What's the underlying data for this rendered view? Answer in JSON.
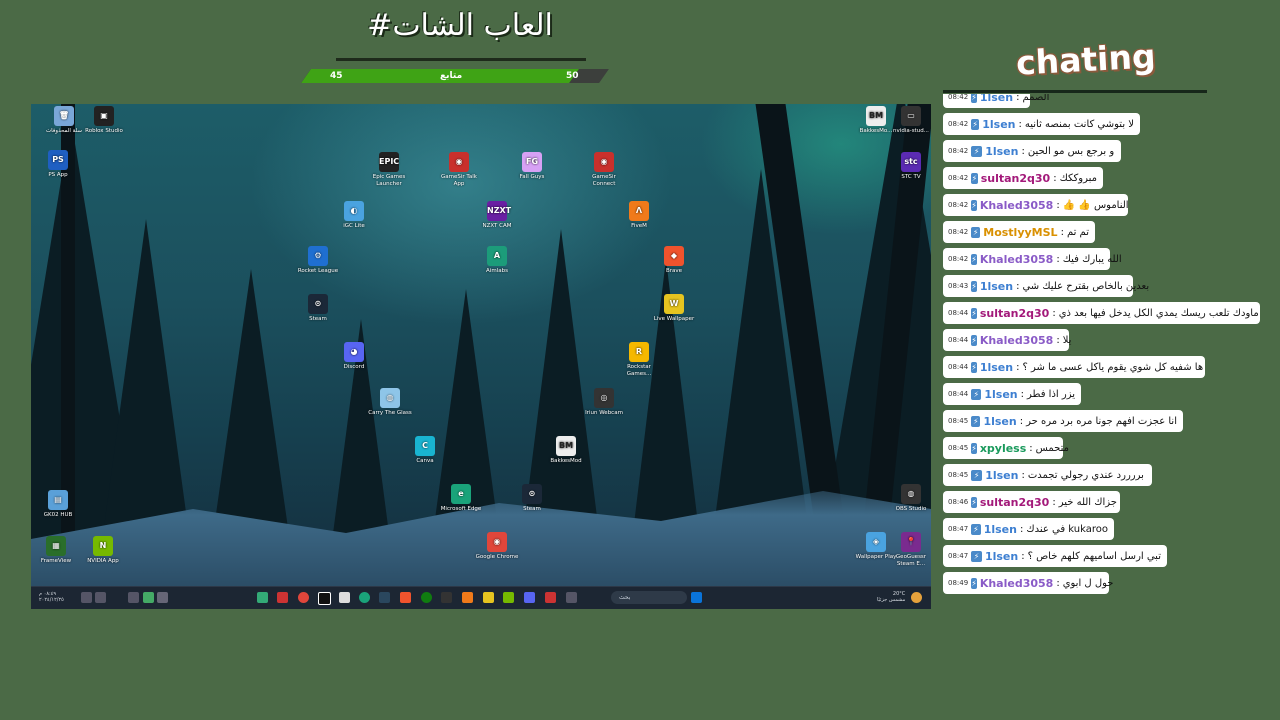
{
  "header": {
    "title": "#العاب الشات",
    "goal": {
      "label": "متابع",
      "current": "45",
      "target": "50",
      "progress": 0.9
    }
  },
  "desktop": {
    "icons": [
      {
        "label": "سلة المحذوفات",
        "color": "#7aa7d8",
        "glyph": "🗑"
      },
      {
        "label": "Roblox Studio",
        "color": "#222",
        "glyph": "▣"
      },
      {
        "label": "PS App",
        "color": "#1f5fc2",
        "glyph": "PS"
      },
      {
        "label": "Epic Games Launcher",
        "color": "#222",
        "glyph": "EPIC"
      },
      {
        "label": "GameSir Talk App",
        "color": "#c9302c",
        "glyph": "◉"
      },
      {
        "label": "Fall Guys",
        "color": "#d7a1f5",
        "glyph": "FG"
      },
      {
        "label": "GameSir Connect",
        "color": "#c9302c",
        "glyph": "◉"
      },
      {
        "label": "iGC Lite",
        "color": "#4aa3e0",
        "glyph": "◐"
      },
      {
        "label": "NZXT CAM",
        "color": "#6a1fa3",
        "glyph": "NZXT"
      },
      {
        "label": "FiveM",
        "color": "#f07a1a",
        "glyph": "Λ"
      },
      {
        "label": "Rocket League",
        "color": "#1f6fd1",
        "glyph": "⚙"
      },
      {
        "label": "Aimlabs",
        "color": "#1c9c7a",
        "glyph": "A"
      },
      {
        "label": "Brave",
        "color": "#f0532d",
        "glyph": "◆"
      },
      {
        "label": "Steam",
        "color": "#1b2838",
        "glyph": "⊙"
      },
      {
        "label": "Live Wallpaper",
        "color": "#e6c420",
        "glyph": "W"
      },
      {
        "label": "Discord",
        "color": "#5865f2",
        "glyph": "◕"
      },
      {
        "label": "Rockstar Games...",
        "color": "#f5b800",
        "glyph": "R"
      },
      {
        "label": "Carry The Glass",
        "color": "#8ec5e8",
        "glyph": "◍"
      },
      {
        "label": "Iriun Webcam",
        "color": "#333",
        "glyph": "◎"
      },
      {
        "label": "Canva",
        "color": "#19b4d1",
        "glyph": "C"
      },
      {
        "label": "BakkesMod",
        "color": "#eeeeee",
        "glyph": "BM"
      },
      {
        "label": "Microsoft Edge",
        "color": "#1aa37a",
        "glyph": "e"
      },
      {
        "label": "Steam",
        "color": "#1b2838",
        "glyph": "⊙"
      },
      {
        "label": "Google Chrome",
        "color": "#e0463b",
        "glyph": "◉"
      },
      {
        "label": "GK02 HUB",
        "color": "#5aa0d8",
        "glyph": "▤"
      },
      {
        "label": "FrameView",
        "color": "#2a6e2a",
        "glyph": "▦"
      },
      {
        "label": "NVIDIA App",
        "color": "#76b900",
        "glyph": "N"
      },
      {
        "label": "BakkesMo...",
        "color": "#eeeeee",
        "glyph": "BM"
      },
      {
        "label": "nvidia-stud...",
        "color": "#333",
        "glyph": "▭"
      },
      {
        "label": "STC TV",
        "color": "#5b2bb3",
        "glyph": "stc"
      },
      {
        "label": "OBS Studio",
        "color": "#333",
        "glyph": "◍"
      },
      {
        "label": "Wallpaper Play",
        "color": "#4aa3e0",
        "glyph": "◈"
      },
      {
        "label": "GeoGuessr Steam E...",
        "color": "#7a2b8f",
        "glyph": "📍"
      }
    ],
    "taskbar": {
      "search_placeholder": "بحث",
      "clock_time": "٠٨:٤٩ م",
      "clock_date": "٢٠٢٤/١٢/٢٥",
      "weather_temp": "20°C",
      "weather_desc": "مشمس جزئيًا"
    }
  },
  "chat": {
    "logo": "chating",
    "messages": [
      {
        "time": "08:42",
        "user": "1lsen",
        "color": "#3d7fd1",
        "text": "الصمم"
      },
      {
        "time": "08:42",
        "user": "1lsen",
        "color": "#3d7fd1",
        "text": "لا بتوشي كانت بمنصه ثانيه"
      },
      {
        "time": "08:42",
        "user": "1lsen",
        "color": "#3d7fd1",
        "text": "و برجع بس مو الحين"
      },
      {
        "time": "08:42",
        "user": "sultan2q30",
        "color": "#a3197a",
        "text": "مبروككك"
      },
      {
        "time": "08:42",
        "user": "Khaled3058",
        "color": "#8a5bc7",
        "text": "الناموس 👍 👍"
      },
      {
        "time": "08:42",
        "user": "MostlyyMSL",
        "color": "#d99000",
        "text": "تم تم"
      },
      {
        "time": "08:42",
        "user": "Khaled3058",
        "color": "#8a5bc7",
        "text": "الله يبارك فيك"
      },
      {
        "time": "08:43",
        "user": "1lsen",
        "color": "#3d7fd1",
        "text": "بعدين بالخاص بقترح عليك شي"
      },
      {
        "time": "08:44",
        "user": "sultan2q30",
        "color": "#a3197a",
        "text": "ماودك تلعب ريسك يمدي الكل يدخل فيها بعد ذي"
      },
      {
        "time": "08:44",
        "user": "Khaled3058",
        "color": "#8a5bc7",
        "text": "يلا"
      },
      {
        "time": "08:44",
        "user": "1lsen",
        "color": "#3d7fd1",
        "text": "ها شفيه كل شوي يقوم ياكل عسى ما شر ؟"
      },
      {
        "time": "08:44",
        "user": "1lsen",
        "color": "#3d7fd1",
        "text": "يزر اذا فطر"
      },
      {
        "time": "08:45",
        "user": "1lsen",
        "color": "#3d7fd1",
        "text": "انا عجزت افهم جونا مره برد مره حر"
      },
      {
        "time": "08:45",
        "user": "xpyless",
        "color": "#1a9a5c",
        "text": "متحمس"
      },
      {
        "time": "08:45",
        "user": "1lsen",
        "color": "#3d7fd1",
        "text": "بررررد عندي رجولي تجمدت"
      },
      {
        "time": "08:46",
        "user": "sultan2q30",
        "color": "#a3197a",
        "text": "جزاك الله خير"
      },
      {
        "time": "08:47",
        "user": "1lsen",
        "color": "#3d7fd1",
        "text": "kukaroo في عندك"
      },
      {
        "time": "08:47",
        "user": "1lsen",
        "color": "#3d7fd1",
        "text": "تبي ارسل اساميهم كلهم خاص ؟"
      },
      {
        "time": "08:49",
        "user": "Khaled3058",
        "color": "#8a5bc7",
        "text": "حول ل ابوي"
      }
    ]
  }
}
